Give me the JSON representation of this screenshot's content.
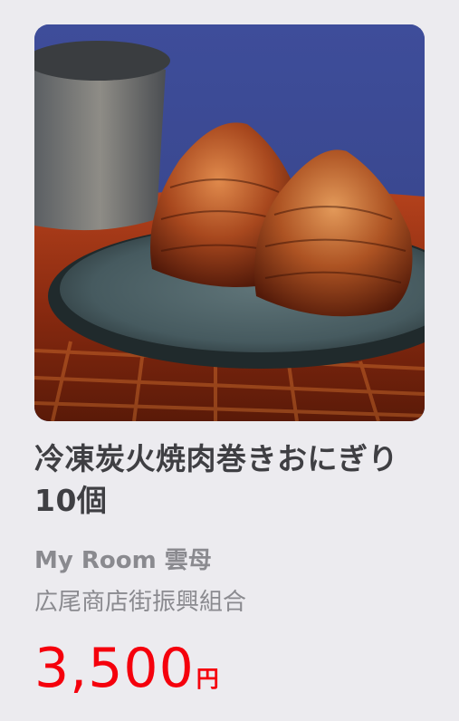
{
  "product": {
    "image_alt": "焼肉巻きおにぎり",
    "title": "冷凍炭火焼肉巻きおにぎり10個",
    "shop_name": "My Room 雲母",
    "shop_org": "広尾商店街振興組合",
    "price": "3,500",
    "price_unit": "円",
    "price_color": "#f5000c"
  }
}
